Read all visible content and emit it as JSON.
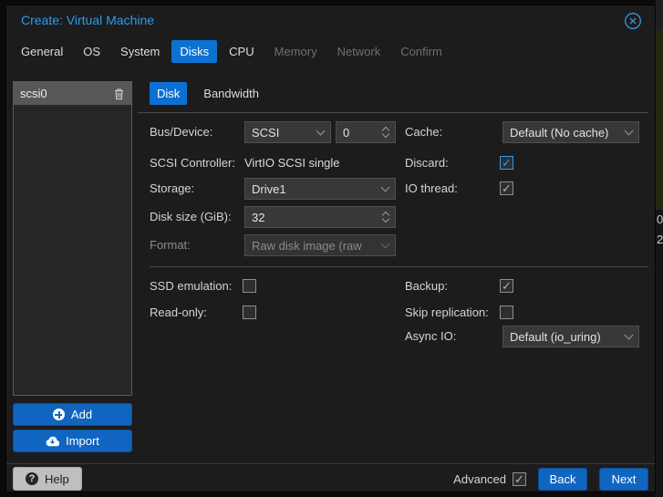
{
  "window": {
    "title": "Create: Virtual Machine"
  },
  "wizard_tabs": [
    {
      "label": "General"
    },
    {
      "label": "OS"
    },
    {
      "label": "System"
    },
    {
      "label": "Disks",
      "active": true
    },
    {
      "label": "CPU"
    },
    {
      "label": "Memory",
      "disabled": true
    },
    {
      "label": "Network",
      "disabled": true
    },
    {
      "label": "Confirm",
      "disabled": true
    }
  ],
  "disk_list": {
    "selected_item": "scsi0",
    "add_label": "Add",
    "import_label": "Import"
  },
  "panel_tabs": {
    "disk": "Disk",
    "bandwidth": "Bandwidth"
  },
  "form": {
    "bus_device": {
      "label": "Bus/Device:",
      "bus": "SCSI",
      "device_number": "0"
    },
    "scsi_controller": {
      "label": "SCSI Controller:",
      "value": "VirtIO SCSI single"
    },
    "storage": {
      "label": "Storage:",
      "value": "Drive1"
    },
    "disk_size": {
      "label": "Disk size (GiB):",
      "value": "32"
    },
    "format": {
      "label": "Format:",
      "value": "Raw disk image (raw",
      "disabled": true
    },
    "cache": {
      "label": "Cache:",
      "value": "Default (No cache)"
    },
    "discard": {
      "label": "Discard:",
      "checked": true,
      "accent": true
    },
    "io_thread": {
      "label": "IO thread:",
      "checked": true
    },
    "ssd_emulation": {
      "label": "SSD emulation:",
      "checked": false
    },
    "read_only": {
      "label": "Read-only:",
      "checked": false
    },
    "backup": {
      "label": "Backup:",
      "checked": true
    },
    "skip_replication": {
      "label": "Skip replication:",
      "checked": false
    },
    "async_io": {
      "label": "Async IO:",
      "value": "Default (io_uring)"
    }
  },
  "footer": {
    "help": "Help",
    "advanced": "Advanced",
    "advanced_checked": true,
    "back": "Back",
    "next": "Next"
  },
  "background": {
    "partial_digit_top": "0",
    "partial_digit_bottom": "2"
  },
  "colors": {
    "accent_blue": "#0d71d2",
    "title_blue": "#2f9ce7",
    "checkbox_accent": "#3b99e0",
    "button_blue": "#1065c0",
    "dialog_bg": "#1c1c1c"
  }
}
